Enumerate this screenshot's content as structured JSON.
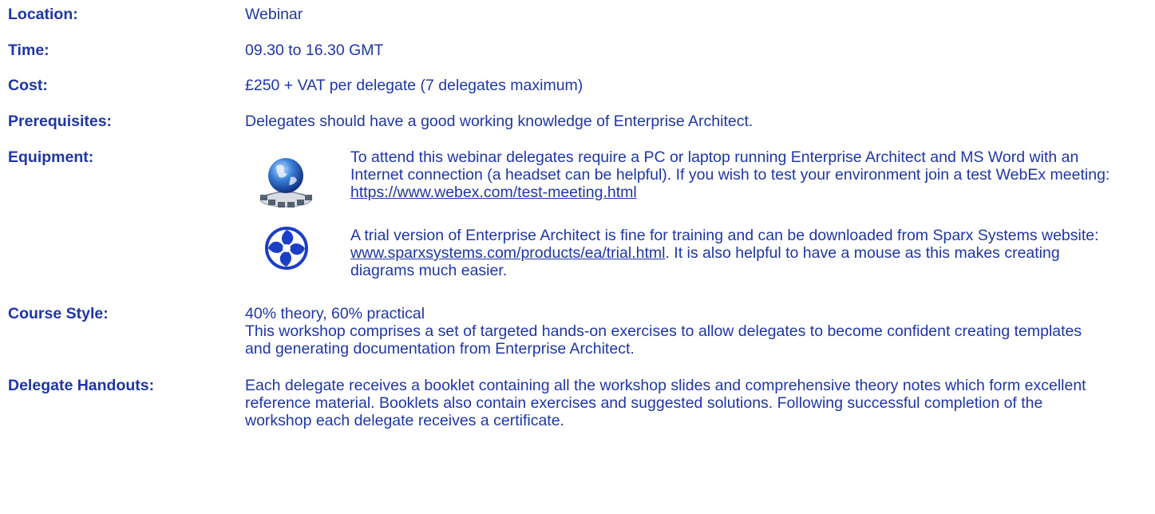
{
  "rows": {
    "location": {
      "label": "Location:",
      "value": "Webinar"
    },
    "time": {
      "label": "Time:",
      "value": "09.30 to 16.30 GMT"
    },
    "cost": {
      "label": "Cost:",
      "value": "£250 + VAT per delegate (7 delegates maximum)"
    },
    "prerequisites": {
      "label": "Prerequisites:",
      "value": "Delegates should have a good working knowledge of Enterprise Architect."
    },
    "equipment": {
      "label": "Equipment:",
      "note1_text": "To attend this webinar delegates require a PC or laptop running Enterprise Architect and MS Word with an Internet connection (a headset can be helpful). If you wish to test your environment join a test WebEx meeting: ",
      "note1_link": "https://www.webex.com/test-meeting.html",
      "note1_icon": "globe-network-icon",
      "note2_text": "A trial version of Enterprise Architect is fine for training and can be downloaded from Sparx Systems website: ",
      "note2_link": "www.sparxsystems.com/products/ea/trial.html",
      "note2_after": ". It is also helpful to have a mouse as this makes creating diagrams much easier.",
      "note2_icon": "sparx-systems-logo-icon"
    },
    "course_style": {
      "label": "Course Style:",
      "line1": "40% theory, 60% practical",
      "line2": "This workshop comprises a set of targeted hands-on exercises to allow delegates to become confident creating templates and generating documentation from Enterprise Architect."
    },
    "handouts": {
      "label": "Delegate Handouts:",
      "value": "Each delegate receives a booklet containing all the workshop slides and comprehensive theory notes which form excellent reference material. Booklets also contain exercises and suggested solutions. Following successful completion of the workshop each delegate receives a certificate."
    }
  },
  "colors": {
    "text": "#1f36a8",
    "background": "#ffffff"
  }
}
